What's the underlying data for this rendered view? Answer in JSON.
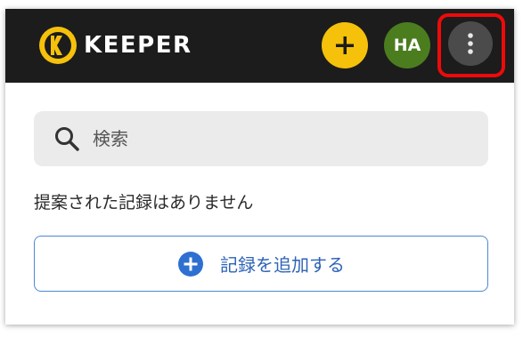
{
  "header": {
    "brand_name": "KEEPER",
    "avatar_initials": "HA",
    "add_button_icon": "plus-icon",
    "more_button_icon": "vertical-dots-icon"
  },
  "search": {
    "placeholder": "検索",
    "value": ""
  },
  "empty_message": "提案された記録はありません",
  "add_record": {
    "label": "記録を追加する",
    "icon": "plus-circle-icon"
  },
  "colors": {
    "header_bg": "#1c1c1c",
    "add_button": "#f5c10a",
    "avatar_bg": "#4b7d1f",
    "more_button_bg": "#4b4b4b",
    "highlight": "#ee0a0a",
    "accent_blue": "#2e63b6"
  }
}
